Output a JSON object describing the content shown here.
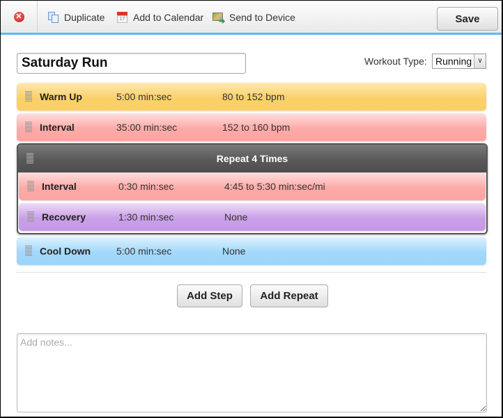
{
  "toolbar": {
    "close_icon": "close-icon",
    "items": [
      {
        "label": "Duplicate",
        "icon": "duplicate-icon"
      },
      {
        "label": "Add to Calendar",
        "icon": "calendar-icon"
      },
      {
        "label": "Send to Device",
        "icon": "send-to-device-icon"
      }
    ],
    "save_label": "Save",
    "accent_color": "#5bbcef"
  },
  "workout": {
    "name": "Saturday Run",
    "type_label": "Workout Type:",
    "type_value": "Running"
  },
  "steps": [
    {
      "name": "Warm Up",
      "duration": "5:00 min:sec",
      "target": "80 to 152 bpm",
      "color": "#fbd06a"
    },
    {
      "name": "Interval",
      "duration": "35:00 min:sec",
      "target": "152 to 160 bpm",
      "color": "#fdaaa7"
    }
  ],
  "repeat": {
    "title": "Repeat 4 Times",
    "steps": [
      {
        "name": "Interval",
        "duration": "0:30 min:sec",
        "target": "4:45 to 5:30 min:sec/mi",
        "color": "#fdaaa7"
      },
      {
        "name": "Recovery",
        "duration": "1:30 min:sec",
        "target": "None",
        "color": "#c99fe8"
      }
    ]
  },
  "cooldown": {
    "name": "Cool Down",
    "duration": "5:00 min:sec",
    "target": "None",
    "color": "#a2d8fb"
  },
  "actions": {
    "add_step": "Add Step",
    "add_repeat": "Add Repeat"
  },
  "notes": {
    "value": "",
    "placeholder": "Add notes..."
  }
}
